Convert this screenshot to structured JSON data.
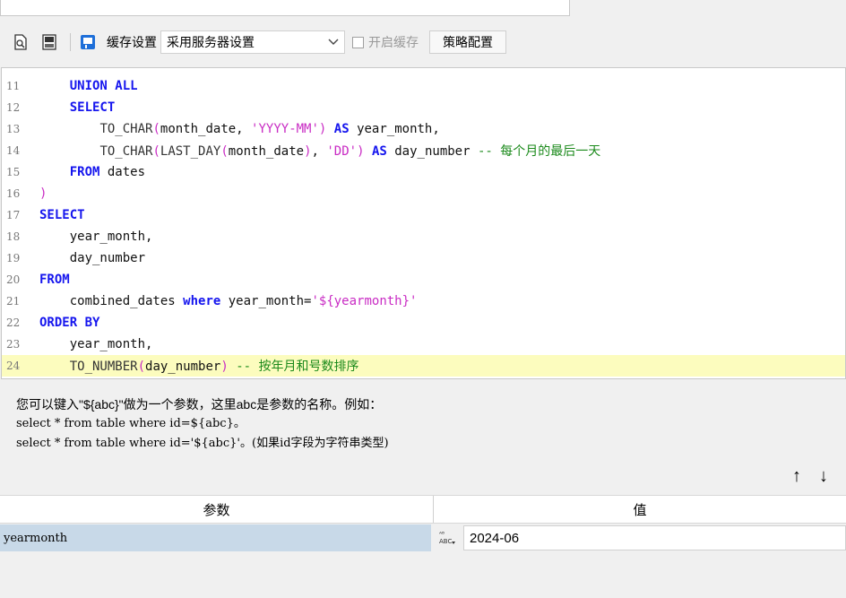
{
  "toolbar": {
    "cache_label": "缓存设置",
    "cache_select_value": "采用服务器设置",
    "enable_cache_label": "开启缓存",
    "strategy_button": "策略配置"
  },
  "editor": {
    "lines": [
      {
        "num": "11"
      },
      {
        "num": "12"
      },
      {
        "num": "13"
      },
      {
        "num": "14"
      },
      {
        "num": "15"
      },
      {
        "num": "16"
      },
      {
        "num": "17"
      },
      {
        "num": "18"
      },
      {
        "num": "19"
      },
      {
        "num": "20"
      },
      {
        "num": "21"
      },
      {
        "num": "22"
      },
      {
        "num": "23"
      },
      {
        "num": "24"
      }
    ],
    "highlighted_line": "24"
  },
  "hint": {
    "line1": "您可以键入\"${abc}\"做为一个参数，这里abc是参数的名称。例如：",
    "line2": "select * from table where id=${abc}。",
    "line3": "select * from table where id='${abc}'。(如果id字段为字符串类型)"
  },
  "params": {
    "col_param": "参数",
    "col_value": "值",
    "rows": [
      {
        "name": "yearmonth",
        "value": "2024-06",
        "type_icon": "abc-type-icon"
      }
    ]
  }
}
